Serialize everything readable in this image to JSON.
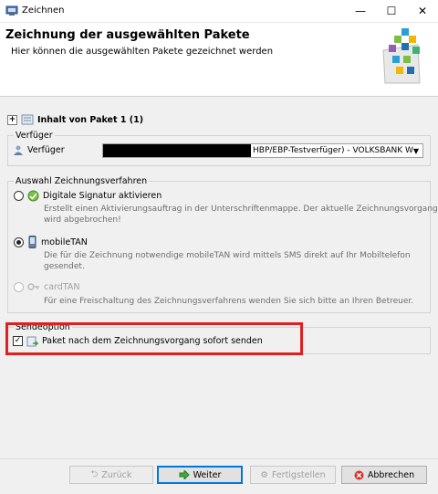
{
  "window": {
    "title": "Zeichnen",
    "minimize_glyph": "—",
    "maximize_glyph": "☐",
    "close_glyph": "✕"
  },
  "header": {
    "title": "Zeichnung der ausgewählten Pakete",
    "subtitle": "Hier können die ausgewählten Pakete gezeichnet werden"
  },
  "package": {
    "expand_glyph": "+",
    "label": "Inhalt von Paket 1 (1)"
  },
  "verfueger_group": {
    "legend": "Verfüger",
    "label": "Verfüger",
    "select_value": "HBP/EBP-Testverfüger) - VOLKSBANK W"
  },
  "method_group": {
    "legend": "Auswahl Zeichnungsverfahren",
    "options": [
      {
        "label": "Digitale Signatur aktivieren",
        "description_line1": "Erstellt einen Aktivierungsauftrag in der Unterschriftenmappe. Der aktuelle Zeichnungsvorgang",
        "description_line2": "wird abgebrochen!",
        "selected": false,
        "enabled": true,
        "icon": "digital-signature-icon"
      },
      {
        "label": "mobileTAN",
        "description_line1": "Die für die Zeichnung notwendige mobileTAN wird mittels SMS direkt auf Ihr Mobiltelefon",
        "description_line2": "gesendet.",
        "selected": true,
        "enabled": true,
        "icon": "mobile-phone-icon"
      },
      {
        "label": "cardTAN",
        "description_line1": "Für eine Freischaltung des Zeichnungsverfahrens wenden Sie sich bitte an Ihren Betreuer.",
        "selected": false,
        "enabled": false,
        "icon": "key-icon"
      }
    ]
  },
  "send_group": {
    "legend": "Sendeoption",
    "checkbox_label": "Paket nach dem Zeichnungsvorgang sofort senden",
    "checked": true,
    "check_glyph": "✓"
  },
  "buttons": {
    "back": "Zurück",
    "next": "Weiter",
    "finish": "Fertigstellen",
    "cancel": "Abbrechen"
  },
  "colors": {
    "highlight": "#e02020",
    "primary_border": "#0078d7"
  }
}
